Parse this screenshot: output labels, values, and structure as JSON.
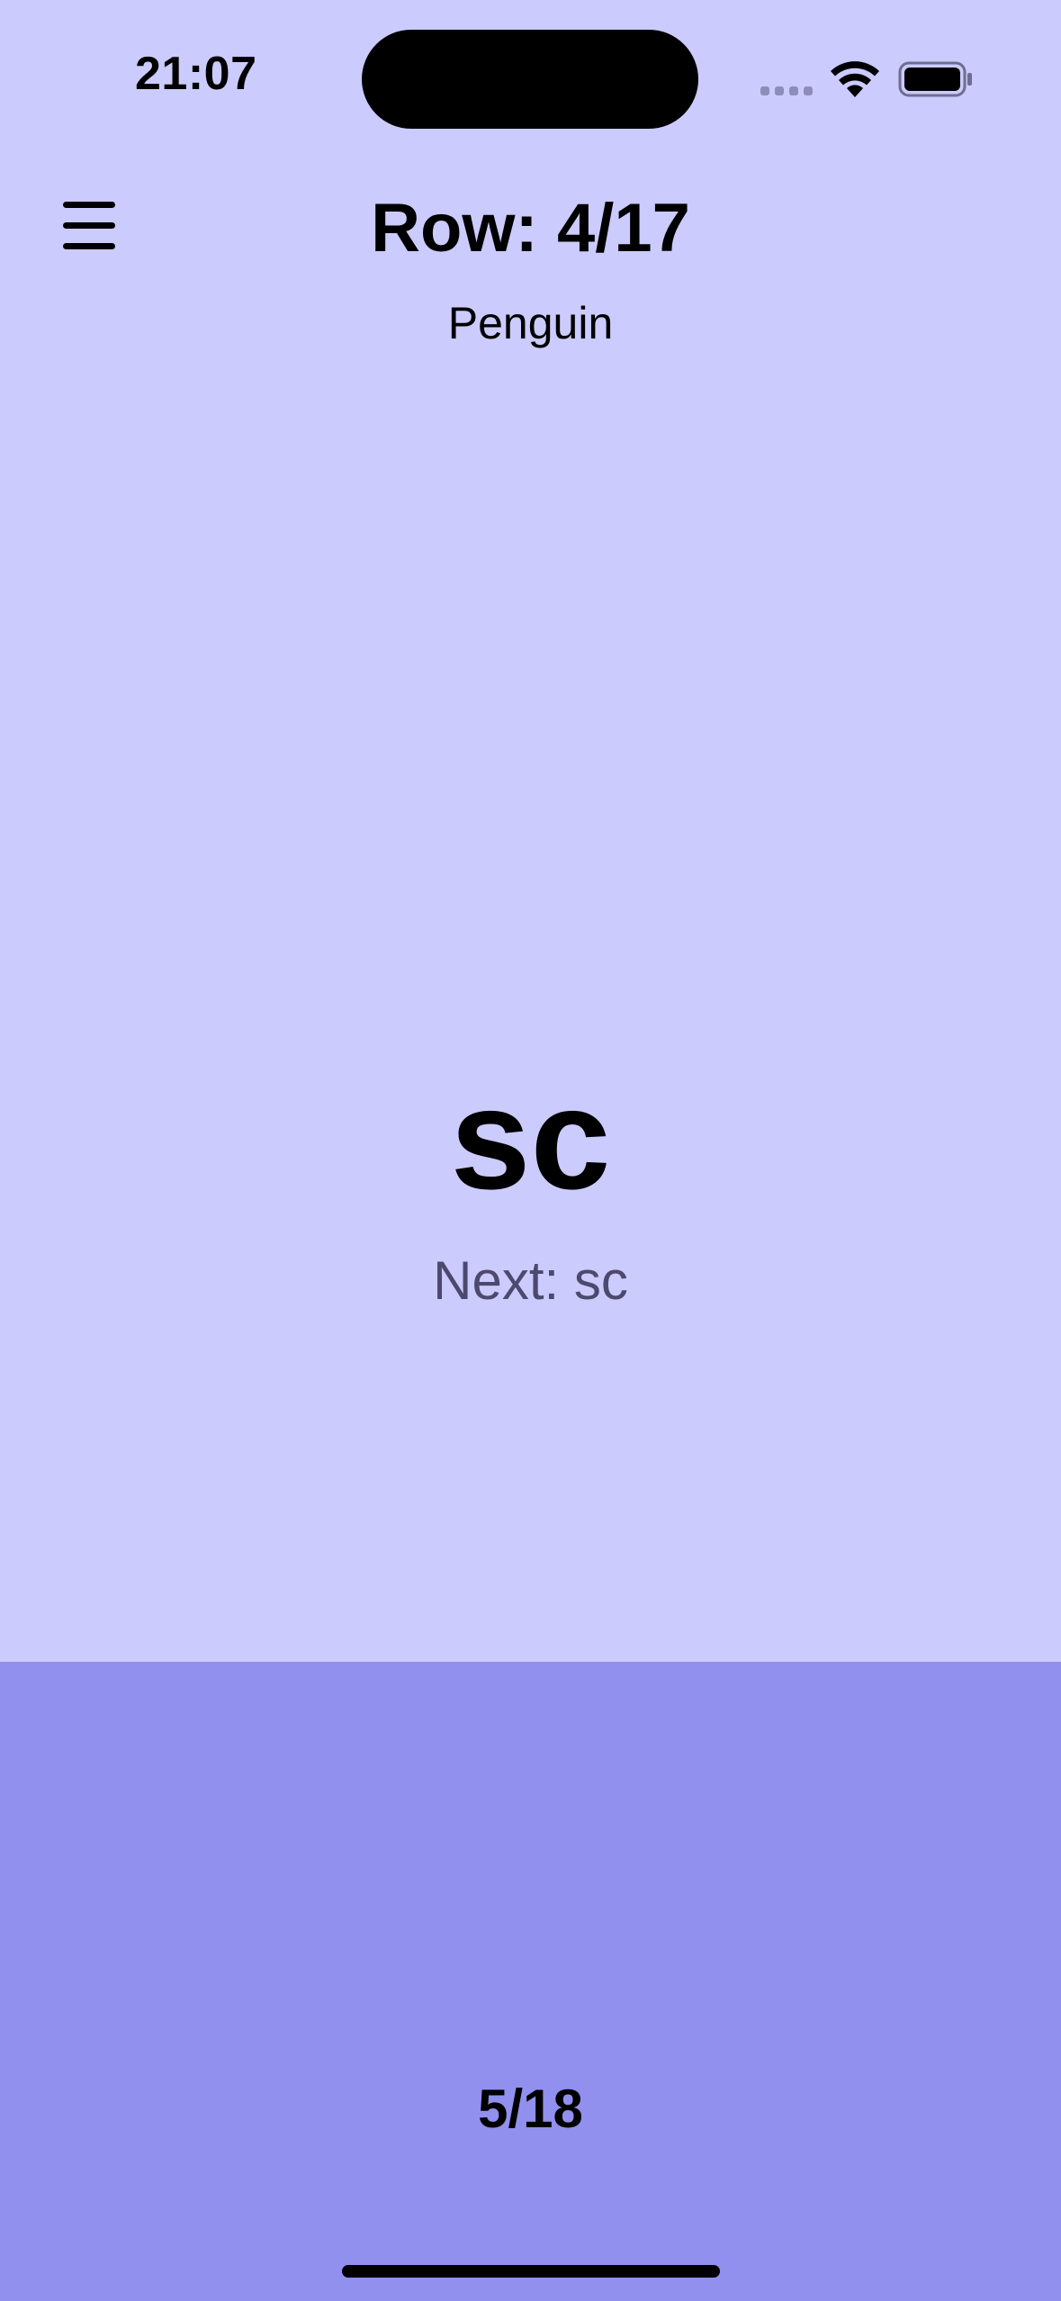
{
  "status_bar": {
    "time": "21:07"
  },
  "header": {
    "menu_icon": "hamburger-menu-icon",
    "row_label": "Row: 4/17",
    "pattern_name": "Penguin"
  },
  "stitch": {
    "current": "sc",
    "next_label": "Next: sc"
  },
  "footer": {
    "stitch_progress": "5/18"
  },
  "colors": {
    "background": "#cccbfe",
    "tap_zone": "#9190ef",
    "next_text": "#4b4a6e"
  }
}
